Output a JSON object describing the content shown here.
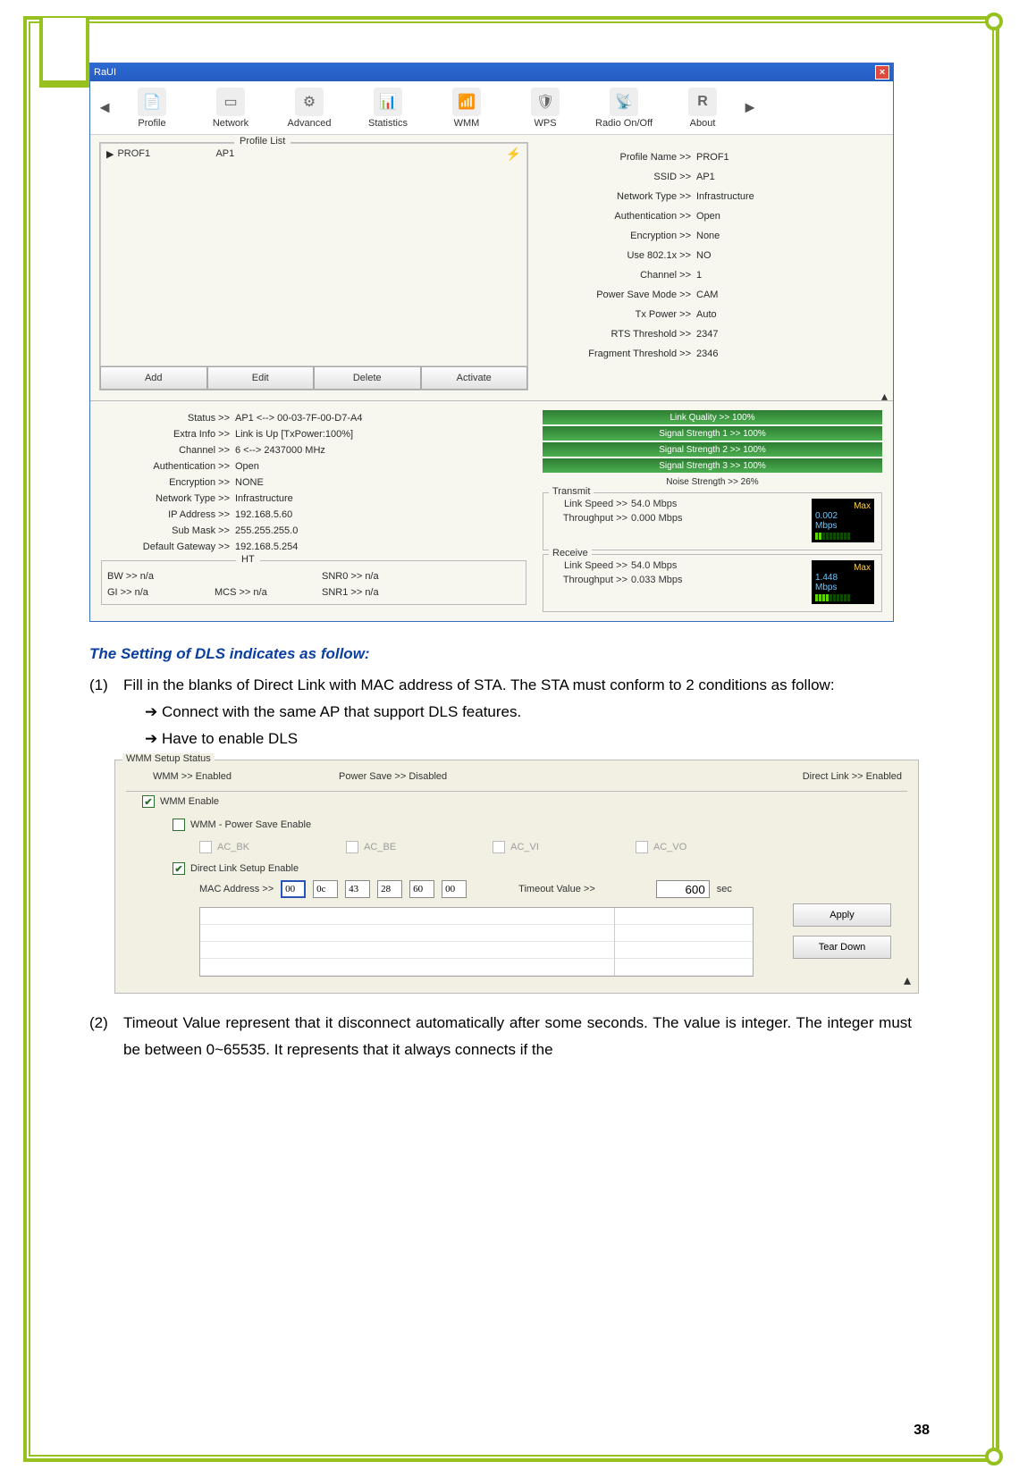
{
  "page_number": "38",
  "raui": {
    "title": "RaUI",
    "toolbar": [
      "Profile",
      "Network",
      "Advanced",
      "Statistics",
      "WMM",
      "WPS",
      "Radio On/Off",
      "About"
    ],
    "profile_list_legend": "Profile List",
    "profile_row": {
      "name": "PROF1",
      "ssid": "AP1"
    },
    "buttons": {
      "add": "Add",
      "edit": "Edit",
      "delete": "Delete",
      "activate": "Activate"
    },
    "info": {
      "profile_name": {
        "l": "Profile Name >>",
        "v": "PROF1"
      },
      "ssid": {
        "l": "SSID >>",
        "v": "AP1"
      },
      "network_type": {
        "l": "Network Type >>",
        "v": "Infrastructure"
      },
      "auth": {
        "l": "Authentication >>",
        "v": "Open"
      },
      "enc": {
        "l": "Encryption >>",
        "v": "None"
      },
      "use8021x": {
        "l": "Use 802.1x >>",
        "v": "NO"
      },
      "channel": {
        "l": "Channel >>",
        "v": "1"
      },
      "psm": {
        "l": "Power Save Mode >>",
        "v": "CAM"
      },
      "txpower": {
        "l": "Tx Power >>",
        "v": "Auto"
      },
      "rts": {
        "l": "RTS Threshold >>",
        "v": "2347"
      },
      "frag": {
        "l": "Fragment Threshold >>",
        "v": "2346"
      }
    },
    "lstatus": {
      "status": {
        "l": "Status >>",
        "v": "AP1 <--> 00-03-7F-00-D7-A4"
      },
      "extra": {
        "l": "Extra Info >>",
        "v": "Link is Up [TxPower:100%]"
      },
      "channel": {
        "l": "Channel >>",
        "v": "6 <--> 2437000 MHz"
      },
      "auth": {
        "l": "Authentication >>",
        "v": "Open"
      },
      "enc": {
        "l": "Encryption >>",
        "v": "NONE"
      },
      "nettype": {
        "l": "Network Type >>",
        "v": "Infrastructure"
      },
      "ip": {
        "l": "IP Address >>",
        "v": "192.168.5.60"
      },
      "mask": {
        "l": "Sub Mask >>",
        "v": "255.255.255.0"
      },
      "gw": {
        "l": "Default Gateway >>",
        "v": "192.168.5.254"
      }
    },
    "ht": {
      "legend": "HT",
      "bw": {
        "l": "BW >>",
        "v": "n/a"
      },
      "snr0": {
        "l": "SNR0 >>",
        "v": "n/a"
      },
      "gi": {
        "l": "GI >>",
        "v": "n/a"
      },
      "mcs": {
        "l": "MCS >>",
        "v": "n/a"
      },
      "snr1": {
        "l": "SNR1 >>",
        "v": "n/a"
      }
    },
    "bars": {
      "lq": "Link Quality >> 100%",
      "s1": "Signal Strength 1 >> 100%",
      "s2": "Signal Strength 2 >> 100%",
      "s3": "Signal Strength 3 >> 100%",
      "noise": "Noise Strength >> 26%"
    },
    "tx": {
      "legend": "Transmit",
      "ls": {
        "l": "Link Speed >>",
        "v": "54.0 Mbps"
      },
      "tp": {
        "l": "Throughput >>",
        "v": "0.000 Mbps"
      },
      "gauge_max": "Max",
      "gauge_v": "0.002",
      "gauge_u": "Mbps"
    },
    "rx": {
      "legend": "Receive",
      "ls": {
        "l": "Link Speed >>",
        "v": "54.0 Mbps"
      },
      "tp": {
        "l": "Throughput >>",
        "v": "0.033 Mbps"
      },
      "gauge_max": "Max",
      "gauge_v": "1.448",
      "gauge_u": "Mbps"
    }
  },
  "doc": {
    "heading": "The Setting of DLS indicates as follow:",
    "item1": "Fill in the blanks of Direct Link with MAC address of STA. The STA must conform to 2 conditions as follow:",
    "sub1": "Connect with the same AP that support DLS features.",
    "sub2": "Have to enable DLS",
    "item2": "Timeout Value represent that it disconnect automatically after some seconds. The value is integer. The integer must be between 0~65535. It represents that it always connects if the"
  },
  "wmm": {
    "legend": "WMM Setup Status",
    "status": {
      "wmm": "WMM >> Enabled",
      "ps": "Power Save >> Disabled",
      "dl": "Direct Link >> Enabled"
    },
    "wmm_enable": "WMM Enable",
    "ps_enable": "WMM - Power Save Enable",
    "ac": {
      "bk": "AC_BK",
      "be": "AC_BE",
      "vi": "AC_VI",
      "vo": "AC_VO"
    },
    "dl_enable": "Direct Link Setup Enable",
    "mac_label": "MAC Address >>",
    "mac": [
      "00",
      "0c",
      "43",
      "28",
      "60",
      "00"
    ],
    "timeout_label": "Timeout Value >>",
    "timeout_value": "600",
    "timeout_unit": "sec",
    "apply": "Apply",
    "teardown": "Tear Down"
  }
}
